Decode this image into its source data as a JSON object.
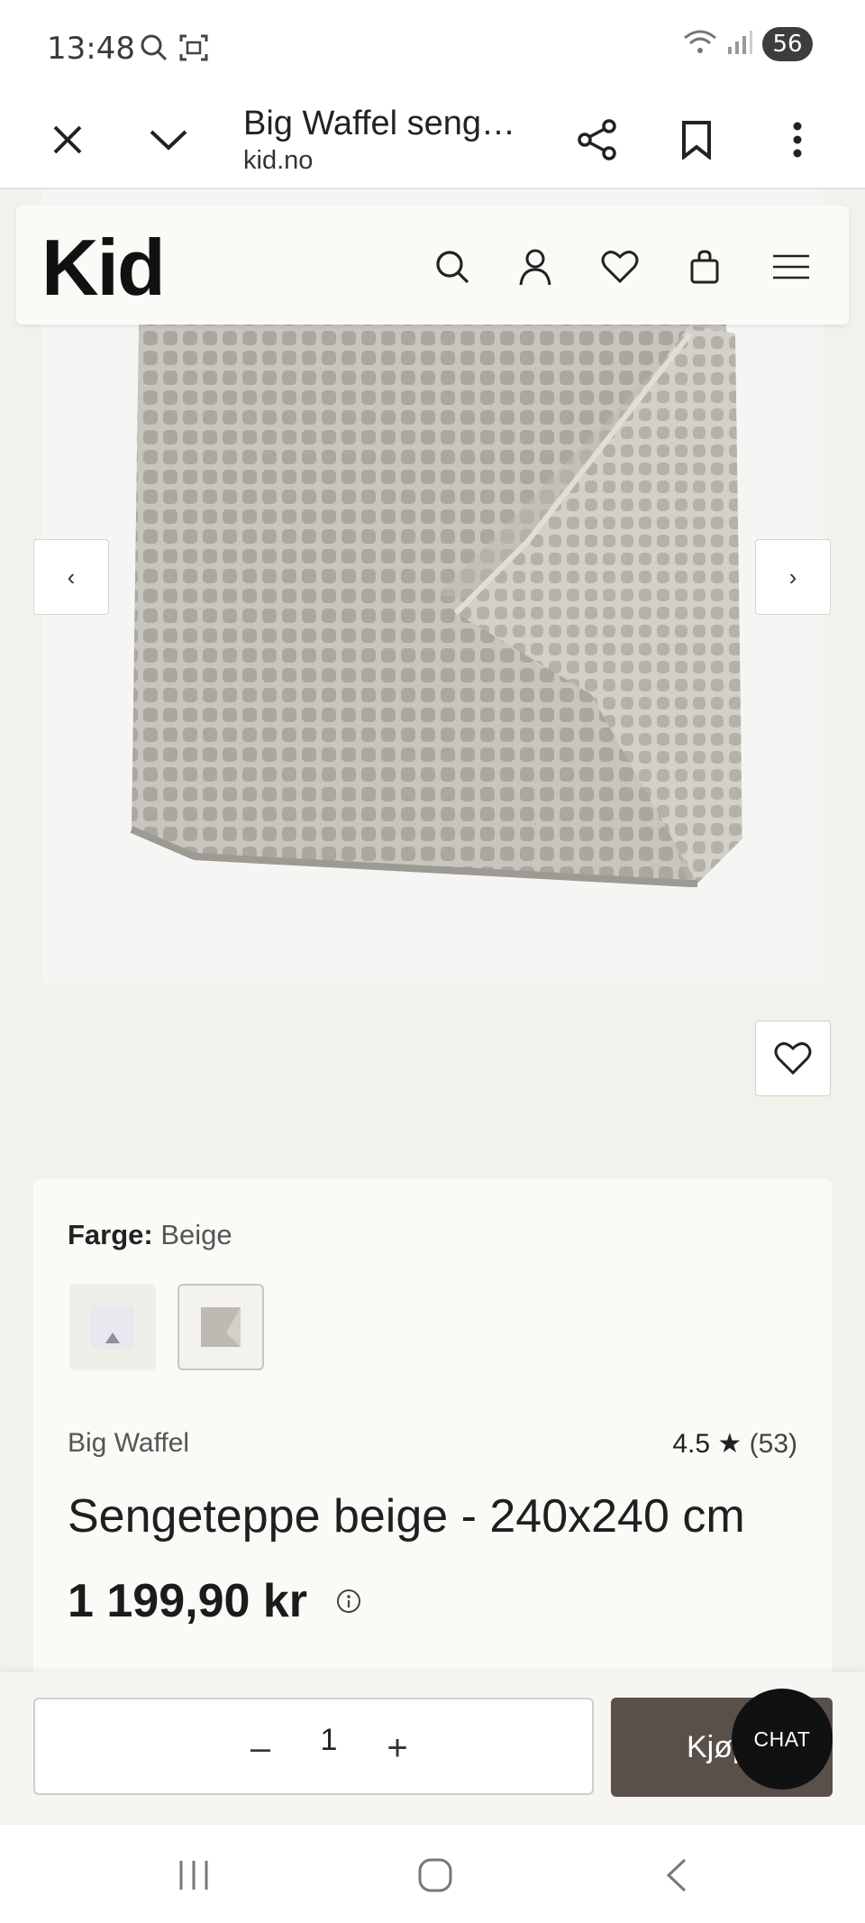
{
  "status_bar": {
    "time": "13:48",
    "battery": "56"
  },
  "browser": {
    "title": "Big Waffel seng…",
    "url": "kid.no"
  },
  "site": {
    "logo": "Kid"
  },
  "product": {
    "color_label": "Farge:",
    "color_value": "Beige",
    "brand": "Big Waffel",
    "rating": "4.5",
    "rating_star": "★",
    "rating_count": "(53)",
    "title": "Sengeteppe beige - 240x240 cm",
    "price": "1 199,90 kr"
  },
  "gallery": {
    "prev": "‹",
    "next": "›"
  },
  "buy_bar": {
    "minus": "–",
    "quantity": "1",
    "plus": "+",
    "buy_label": "Kjøp",
    "chat_label": "CHAT"
  },
  "colors": {
    "buy_button": "#5a504a",
    "page_bg": "#f3f1ec",
    "card_bg": "#fbfaf7"
  }
}
